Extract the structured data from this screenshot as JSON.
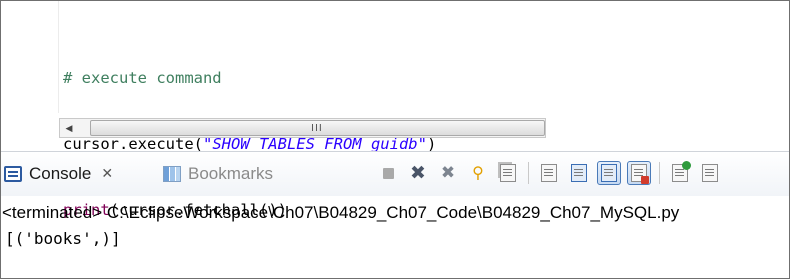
{
  "editor": {
    "lines": [
      "# execute command",
      "cursor.execute(",
      "\"SHOW TABLES FROM ",
      "guidb",
      "\"",
      ")",
      "print",
      "(cursor.fetchall())"
    ],
    "scrollbar_grip": "III"
  },
  "views": {
    "tabs": [
      {
        "label": "Console",
        "icon": "console-icon",
        "active": true,
        "close": "✕"
      },
      {
        "label": "Bookmarks",
        "icon": "bookmarks-icon",
        "active": false
      }
    ]
  },
  "toolbar": {
    "icons": [
      "terminate-icon",
      "remove-launch-icon",
      "remove-all-terminated-icon",
      "pin-console-icon",
      "display-selected-console-icon",
      "clear-console-icon",
      "scroll-lock-icon",
      "show-console-on-stdout-icon",
      "show-console-on-stderr-icon",
      "open-console-icon",
      "console-view-menu-icon"
    ]
  },
  "console": {
    "status": "<terminated> C:\\EclipseWorkspace\\Ch07\\B04829_Ch07_Code\\B04829_Ch07_MySQL.py",
    "output": "[('books',)]"
  },
  "colors": {
    "comment": "#3f7f5f",
    "string": "#2a00ff",
    "builtin": "#7f0055",
    "tab_icon": "#2c5aa0"
  }
}
